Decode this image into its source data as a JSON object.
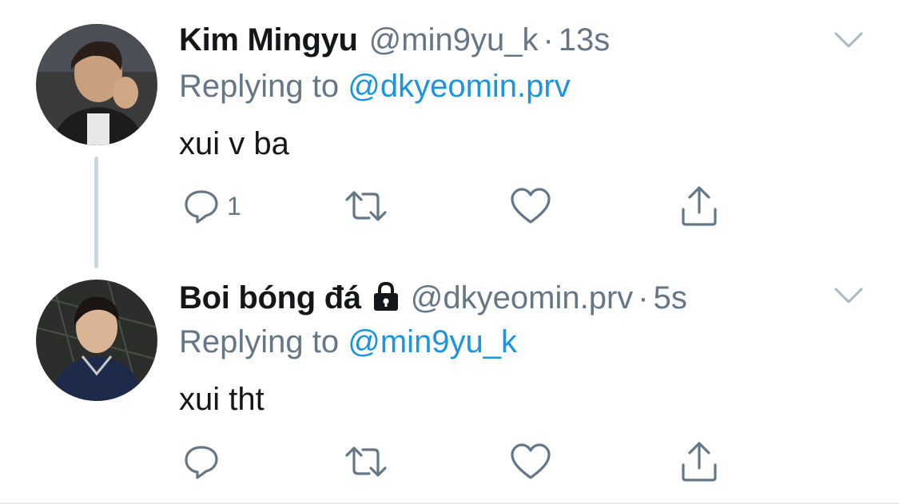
{
  "tweets": [
    {
      "name": "Kim Mingyu",
      "handle": "@min9yu_k",
      "dot": "·",
      "time": "13s",
      "replying_prefix": "Replying to",
      "replying_mention": "@dkyeomin.prv",
      "text": "xui v ba",
      "reply_count": "1",
      "avatar_icon": "profile-photo",
      "protected": false
    },
    {
      "name": "Boi bóng đá",
      "handle": "@dkyeomin.prv",
      "dot": "·",
      "time": "5s",
      "replying_prefix": "Replying to",
      "replying_mention": "@min9yu_k",
      "text": "xui tht",
      "reply_count": "",
      "avatar_icon": "profile-photo",
      "protected": true
    }
  ],
  "colors": {
    "text": "#14171a",
    "secondary": "#657786",
    "link": "#1b95e0",
    "thread_line": "#ccd6dd"
  },
  "icons": [
    "reply-icon",
    "retweet-icon",
    "like-icon",
    "share-icon",
    "chevron-down-icon",
    "lock-icon"
  ]
}
